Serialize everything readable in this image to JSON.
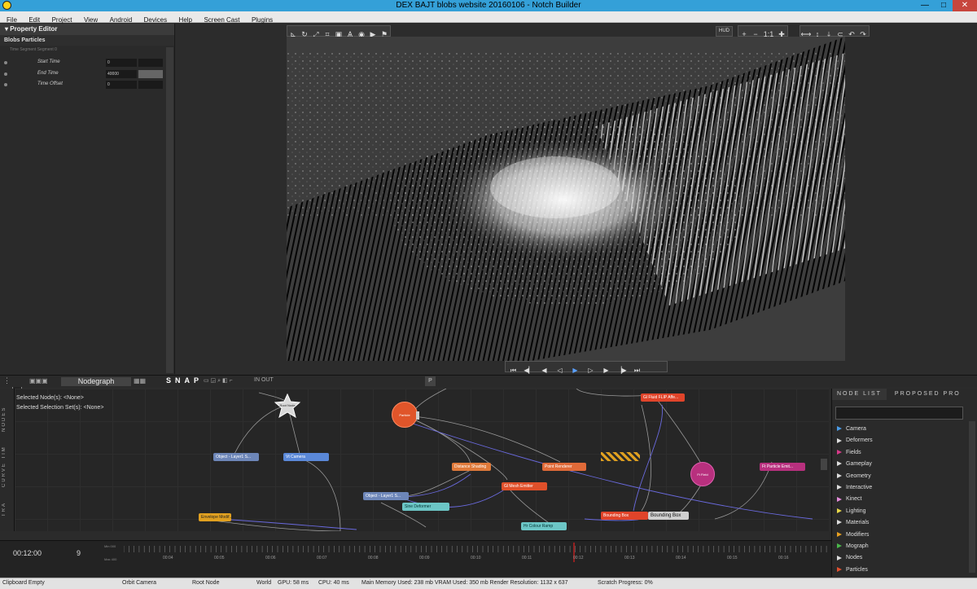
{
  "window": {
    "title": "DEX BAJT blobs website 20160106 - Notch Builder",
    "controls": {
      "minimize": "—",
      "maximize": "□",
      "close": "✕"
    }
  },
  "menu": [
    "File",
    "Edit",
    "Project",
    "View",
    "Android",
    "Devices",
    "Help",
    "Screen Cast",
    "Plugins"
  ],
  "property_editor": {
    "title": "Property Editor",
    "node_name": "Blobs Particles",
    "segment": "Time Segment Segment 0",
    "properties": [
      {
        "label": "Start Time",
        "value": "0"
      },
      {
        "label": "End Time",
        "value": "40000"
      },
      {
        "label": "Time Offset",
        "value": "0"
      }
    ]
  },
  "viewport": {
    "hud_label": "HUD",
    "zoom_label": "1:1"
  },
  "nodegraph": {
    "title": "Nodegraph",
    "snap_label": "SNAP",
    "in_out": "IN OUT",
    "p_label": "P",
    "selected_nodes_label": "Selected  Node(s):",
    "selected_nodes_value": "<None>",
    "selected_sets_label": "Selected  Selection  Set(s):",
    "selected_sets_value": "<None>",
    "side_tabs": [
      "NODES",
      "CURVE TIM",
      "TRA"
    ],
    "nodes": [
      {
        "label": "Root  Node",
        "color": "#d8d8d8"
      },
      {
        "label": "Particle",
        "color": "#e0552a"
      },
      {
        "label": "Object - Layer1 S...",
        "color": "#6d86b8"
      },
      {
        "label": "Vt  Camera",
        "color": "#5a88d8"
      },
      {
        "label": "Distance  Shading",
        "color": "#e07a3a"
      },
      {
        "label": "Point  Renderer",
        "color": "#e06a38"
      },
      {
        "label": "Gl  Mesh  Emitter",
        "color": "#e0502a"
      },
      {
        "label": "Object - Layer1 S...",
        "color": "#6d86b8"
      },
      {
        "label": "Sine  Deformer",
        "color": "#6cc6c6"
      },
      {
        "label": "Hr  Colour  Ramp",
        "color": "#6cc6c6"
      },
      {
        "label": "Gl  Fluid  FLIP  Affe...",
        "color": "#e0442a"
      },
      {
        "label": "Bounding  Box",
        "color": "#e0442a"
      },
      {
        "label": "Bounding  Box",
        "color": "#cfcfcf"
      },
      {
        "label": "Ft  Field",
        "color": "#b8307e"
      },
      {
        "label": "Ft  Particle  Emit...",
        "color": "#b8307e"
      },
      {
        "label": "Envelope  Modif...",
        "color": "#e0a020"
      }
    ]
  },
  "node_list": {
    "tabs": [
      "NODE LIST",
      "PROPOSED PRO"
    ],
    "categories": [
      {
        "label": "Camera",
        "color": "#4a9be6"
      },
      {
        "label": "Deformers",
        "color": "#dddddd"
      },
      {
        "label": "Fields",
        "color": "#d83a8a"
      },
      {
        "label": "Gameplay",
        "color": "#dddddd"
      },
      {
        "label": "Geometry",
        "color": "#dddddd"
      },
      {
        "label": "Interactive",
        "color": "#dddddd"
      },
      {
        "label": "Kinect",
        "color": "#e38ad8"
      },
      {
        "label": "Lighting",
        "color": "#e8d84a"
      },
      {
        "label": "Materials",
        "color": "#dddddd"
      },
      {
        "label": "Modifiers",
        "color": "#e8a020"
      },
      {
        "label": "Mograph",
        "color": "#4ab84a"
      },
      {
        "label": "Nodes",
        "color": "#dddddd"
      },
      {
        "label": "Particles",
        "color": "#e05030"
      }
    ]
  },
  "timeline": {
    "time": "00:12:00",
    "frame": "9",
    "row_labels": [
      "Min 000",
      "Max 400"
    ],
    "ticks": [
      "00:04",
      "00:05",
      "00:06",
      "00:07",
      "00:08",
      "00:09",
      "00:10",
      "00:11",
      "00:12",
      "00:13",
      "00:14",
      "00:15",
      "00:16"
    ]
  },
  "status": {
    "clipboard": "Clipboard Empty",
    "camera": "Orbit Camera",
    "root": "Root Node",
    "world": "World",
    "gpu": "GPU: 58 ms",
    "cpu": "CPU: 40 ms",
    "memory": "Main Memory Used: 238 mb  VRAM Used: 350 mb  Render Resolution: 1132 x 637",
    "scratch": "Scratch Progress: 0%"
  },
  "colors": {
    "titlebar": "#34a0d8",
    "panel": "#2a2a2a",
    "viewport": "#3d3d3d",
    "playhead": "#e02020"
  },
  "icons": {
    "app": "notch-logo-icon",
    "viewport_tools": [
      "axis-icon",
      "rotate-icon",
      "scale-icon",
      "crop-icon",
      "frame-icon",
      "ak-icon",
      "camera-icon",
      "play-icon",
      "flag-icon"
    ],
    "transport": [
      "skip-start-icon",
      "prev-key-icon",
      "step-back-icon",
      "play-back-icon",
      "play-icon",
      "play-forward-icon",
      "step-forward-icon",
      "next-key-icon",
      "skip-end-icon"
    ]
  }
}
